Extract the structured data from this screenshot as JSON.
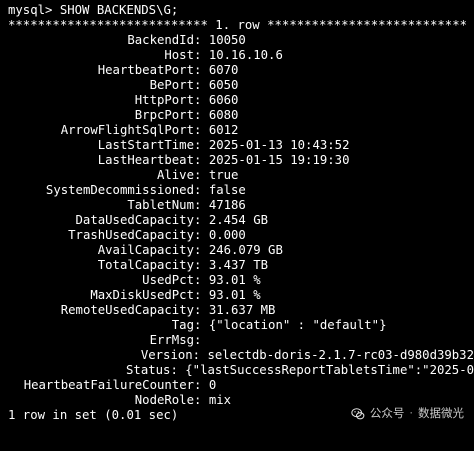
{
  "prompt": "mysql> SHOW BACKENDS\\G;",
  "row_header": "*************************** 1. row ***************************",
  "fields": [
    {
      "key": "BackendId",
      "value": "10050"
    },
    {
      "key": "Host",
      "value": "10.16.10.6"
    },
    {
      "key": "HeartbeatPort",
      "value": "6070"
    },
    {
      "key": "BePort",
      "value": "6050"
    },
    {
      "key": "HttpPort",
      "value": "6060"
    },
    {
      "key": "BrpcPort",
      "value": "6080"
    },
    {
      "key": "ArrowFlightSqlPort",
      "value": "6012"
    },
    {
      "key": "LastStartTime",
      "value": "2025-01-13 10:43:52"
    },
    {
      "key": "LastHeartbeat",
      "value": "2025-01-15 19:19:30"
    },
    {
      "key": "Alive",
      "value": "true"
    },
    {
      "key": "SystemDecommissioned",
      "value": "false"
    },
    {
      "key": "TabletNum",
      "value": "47186"
    },
    {
      "key": "DataUsedCapacity",
      "value": "2.454 GB"
    },
    {
      "key": "TrashUsedCapacity",
      "value": "0.000"
    },
    {
      "key": "AvailCapacity",
      "value": "246.079 GB"
    },
    {
      "key": "TotalCapacity",
      "value": "3.437 TB"
    },
    {
      "key": "UsedPct",
      "value": "93.01 %"
    },
    {
      "key": "MaxDiskUsedPct",
      "value": "93.01 %"
    },
    {
      "key": "RemoteUsedCapacity",
      "value": "31.637 MB"
    },
    {
      "key": "Tag",
      "value": "{\"location\" : \"default\"}"
    },
    {
      "key": "ErrMsg",
      "value": ""
    },
    {
      "key": "Version",
      "value": "selectdb-doris-2.1.7-rc03-d980d39b32"
    },
    {
      "key": "Status",
      "value": "{\"lastSuccessReportTabletsTime\":\"2025-0"
    },
    {
      "key": "HeartbeatFailureCounter",
      "value": "0"
    },
    {
      "key": "NodeRole",
      "value": "mix"
    }
  ],
  "footer": "1 row in set (0.01 sec)",
  "watermark": {
    "account": "公众号",
    "separator": "·",
    "name": "数据微光"
  },
  "colors": {
    "background": "#000000",
    "text": "#ffffff"
  }
}
